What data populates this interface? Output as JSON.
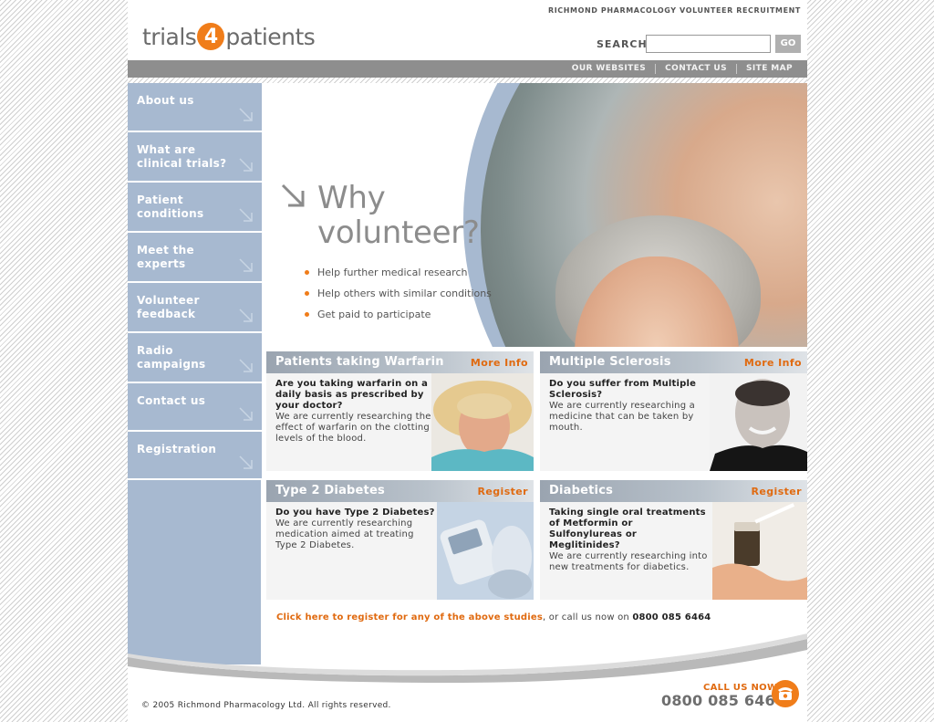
{
  "header": {
    "tagline": "RICHMOND PHARMACOLOGY VOLUNTEER RECRUITMENT",
    "logo_pre": "trials",
    "logo_num": "4",
    "logo_post": "patients",
    "search_label": "SEARCH",
    "search_value": "",
    "go_label": "GO"
  },
  "topnav": [
    "OUR WEBSITES",
    "CONTACT US",
    "SITE MAP"
  ],
  "sidebar": {
    "items": [
      {
        "label_1": "About us",
        "label_2": ""
      },
      {
        "label_1": "What are",
        "label_2": "clinical trials?"
      },
      {
        "label_1": "Patient",
        "label_2": "conditions"
      },
      {
        "label_1": "Meet the",
        "label_2": "experts"
      },
      {
        "label_1": "Volunteer",
        "label_2": "feedback"
      },
      {
        "label_1": "Radio",
        "label_2": "campaigns"
      },
      {
        "label_1": "Contact us",
        "label_2": ""
      },
      {
        "label_1": "Registration",
        "label_2": ""
      }
    ]
  },
  "hero": {
    "title_1": "Why",
    "title_2": "volunteer?",
    "bullets": [
      "Help further medical research",
      "Help others with similar conditions",
      "Get paid to participate"
    ]
  },
  "studies": [
    {
      "title": "Patients taking Warfarin",
      "link": "More Info",
      "question": "Are you taking warfarin on a daily basis as prescribed by your doctor?",
      "body": "We are currently researching the effect of warfarin on the clotting levels of the blood."
    },
    {
      "title": "Multiple Sclerosis",
      "link": "More Info",
      "question": "Do you suffer from Multiple Sclerosis?",
      "body": "We are currently researching a medicine that can be taken by mouth."
    },
    {
      "title": "Type 2 Diabetes",
      "link": "Register",
      "question": "Do you have Type 2 Diabetes?",
      "body": "We are currently researching medication aimed at treating Type 2 Diabetes."
    },
    {
      "title": "Diabetics",
      "link": "Register",
      "question": "Taking single oral treatments of Metformin or Sulfonylureas or Meglitinides?",
      "body": "We are currently researching into new treatments for diabetics."
    }
  ],
  "cta": {
    "link": "Click here to register for any of the above studies",
    "text": ", or call us now on ",
    "phone": "0800 085 6464"
  },
  "footer": {
    "copyright": "© 2005 Richmond Pharmacology Ltd. All rights reserved.",
    "call_label": "CALL US NOW",
    "call_number": "0800 085 6464"
  },
  "colors": {
    "accent": "#f07d1a",
    "sidebar": "#a7b9d0",
    "nav_bar": "#8e8e8e"
  }
}
